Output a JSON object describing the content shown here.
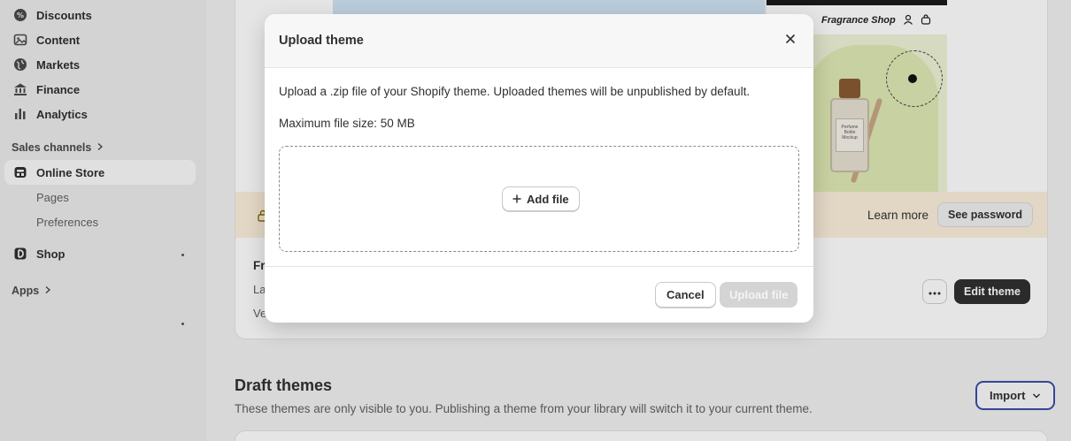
{
  "sidebar": {
    "items": [
      {
        "label": "Discounts",
        "icon": "discount-icon"
      },
      {
        "label": "Content",
        "icon": "content-icon"
      },
      {
        "label": "Markets",
        "icon": "globe-icon"
      },
      {
        "label": "Finance",
        "icon": "bank-icon"
      },
      {
        "label": "Analytics",
        "icon": "bar-chart-icon"
      }
    ],
    "sales_channels_label": "Sales channels",
    "online_store_label": "Online Store",
    "online_store_sub": [
      "Pages",
      "Preferences"
    ],
    "shop_label": "Shop",
    "apps_label": "Apps"
  },
  "theme_card": {
    "preview_shop_name": "Fragrance Shop",
    "learn_more": "Learn more",
    "see_password": "See password",
    "name_partial": "Fr",
    "line1_partial": "La",
    "line2_partial": "Ve",
    "edit_theme": "Edit theme"
  },
  "draft": {
    "title": "Draft themes",
    "description": "These themes are only visible to you. Publishing a theme from your library will switch it to your current theme.",
    "import_label": "Import"
  },
  "modal": {
    "title": "Upload theme",
    "description": "Upload a .zip file of your Shopify theme. Uploaded themes will be unpublished by default.",
    "max_size": "Maximum file size: 50 MB",
    "add_file": "Add file",
    "cancel": "Cancel",
    "upload": "Upload file"
  },
  "colors": {
    "primary_dark": "#303030",
    "import_border": "#3a4ea8",
    "notice_bg": "#fcf0dc",
    "disabled_btn": "#d4d4d4"
  }
}
